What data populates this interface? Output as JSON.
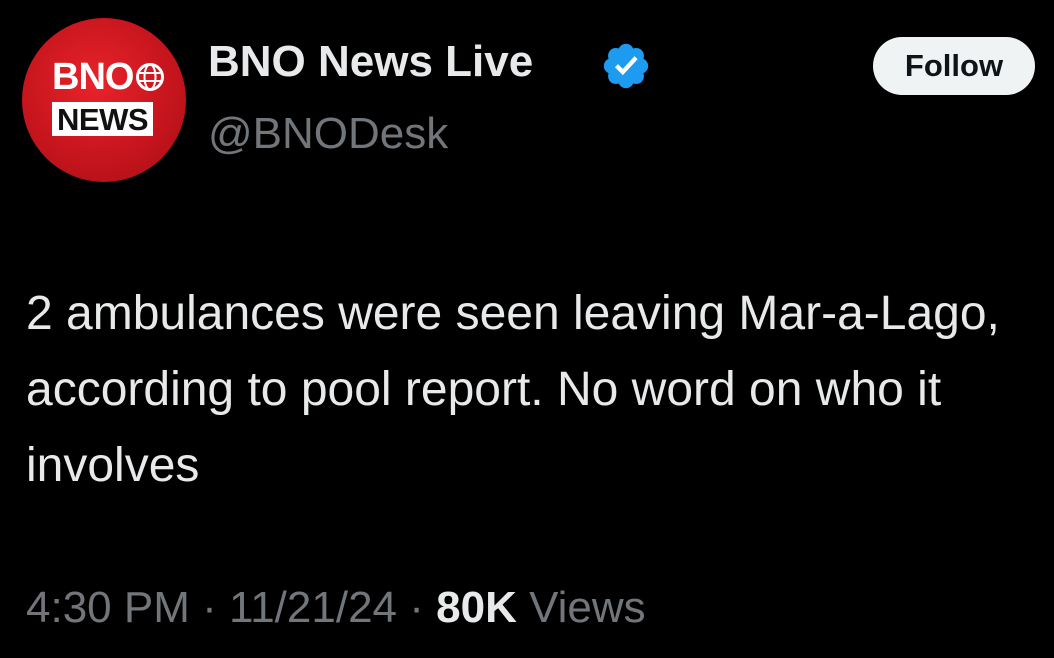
{
  "author": {
    "display_name": "BNO News Live",
    "handle": "@BNODesk",
    "verified": true,
    "avatar": {
      "logo_line1": "BNO",
      "logo_line2": "NEWS",
      "bg_color": "#d01820"
    }
  },
  "follow_button": {
    "label": "Follow"
  },
  "tweet": {
    "text": "2 ambulances were seen leaving Mar-a-Lago, according to pool report. No word on who it involves"
  },
  "meta": {
    "time": "4:30 PM",
    "separator": "·",
    "date": "11/21/24",
    "views_count": "80K",
    "views_label": "Views"
  },
  "icons": {
    "verified": "verified-badge-icon",
    "globe": "globe-icon"
  },
  "colors": {
    "background": "#000000",
    "primary_text": "#e7e9ea",
    "secondary_text": "#71767b",
    "verified_blue": "#1d9bf0",
    "button_bg": "#eff3f4"
  }
}
